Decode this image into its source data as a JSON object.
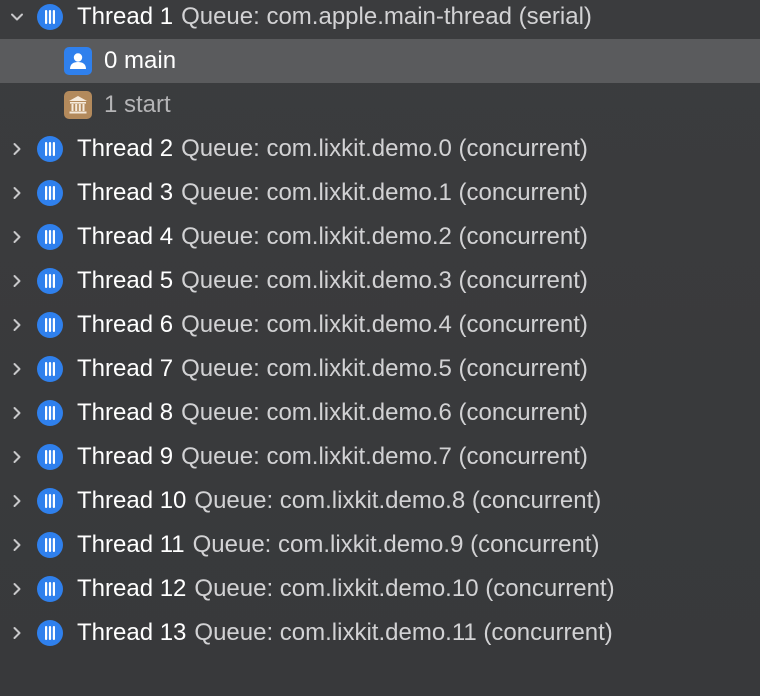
{
  "threads": [
    {
      "name": "Thread 1",
      "queue": "Queue: com.apple.main-thread (serial)",
      "expanded": true
    },
    {
      "name": "Thread 2",
      "queue": "Queue: com.lixkit.demo.0 (concurrent)",
      "expanded": false
    },
    {
      "name": "Thread 3",
      "queue": "Queue: com.lixkit.demo.1 (concurrent)",
      "expanded": false
    },
    {
      "name": "Thread 4",
      "queue": "Queue: com.lixkit.demo.2 (concurrent)",
      "expanded": false
    },
    {
      "name": "Thread 5",
      "queue": "Queue: com.lixkit.demo.3 (concurrent)",
      "expanded": false
    },
    {
      "name": "Thread 6",
      "queue": "Queue: com.lixkit.demo.4 (concurrent)",
      "expanded": false
    },
    {
      "name": "Thread 7",
      "queue": "Queue: com.lixkit.demo.5 (concurrent)",
      "expanded": false
    },
    {
      "name": "Thread 8",
      "queue": "Queue: com.lixkit.demo.6 (concurrent)",
      "expanded": false
    },
    {
      "name": "Thread 9",
      "queue": "Queue: com.lixkit.demo.7 (concurrent)",
      "expanded": false
    },
    {
      "name": "Thread 10",
      "queue": "Queue: com.lixkit.demo.8 (concurrent)",
      "expanded": false
    },
    {
      "name": "Thread 11",
      "queue": "Queue: com.lixkit.demo.9 (concurrent)",
      "expanded": false
    },
    {
      "name": "Thread 12",
      "queue": "Queue: com.lixkit.demo.10 (concurrent)",
      "expanded": false
    },
    {
      "name": "Thread 13",
      "queue": "Queue: com.lixkit.demo.11 (concurrent)",
      "expanded": false
    }
  ],
  "frames": [
    {
      "label": "0 main",
      "icon": "user-code-icon",
      "selected": true
    },
    {
      "label": "1 start",
      "icon": "system-library-icon",
      "selected": false
    }
  ],
  "colors": {
    "background": "#38393b",
    "selected_row": "#5a5b5d",
    "thread_icon": "#2f80ed",
    "user_frame_icon": "#2f80ed",
    "system_frame_icon": "#b38a5c",
    "queue_text": "#d2d2d4",
    "dim_frame_text": "#b4b4b6"
  }
}
